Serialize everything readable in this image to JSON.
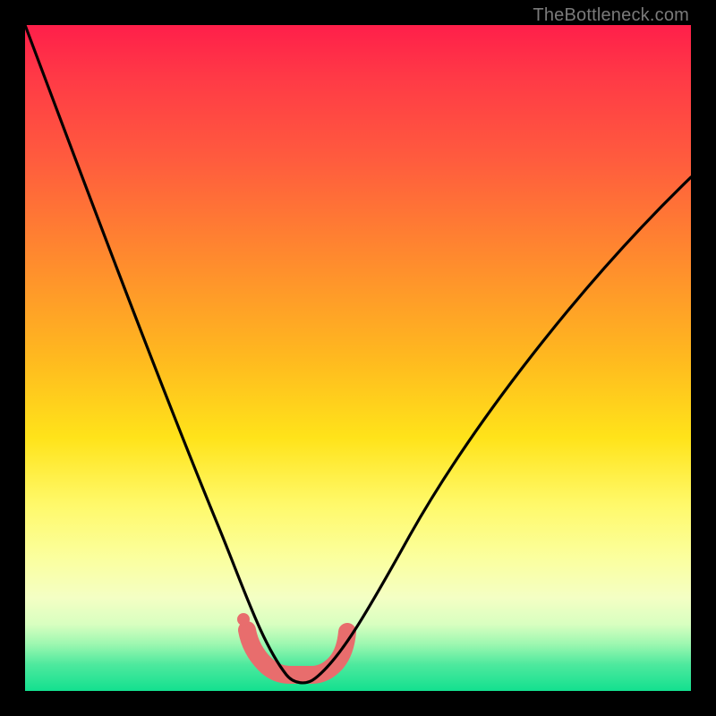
{
  "watermark": {
    "text": "TheBottleneck.com"
  },
  "chart_data": {
    "type": "line",
    "title": "",
    "xlabel": "",
    "ylabel": "",
    "xlim": [
      0,
      100
    ],
    "ylim": [
      0,
      100
    ],
    "grid": false,
    "legend": false,
    "series": [
      {
        "name": "curve",
        "x": [
          0,
          4,
          8,
          12,
          16,
          20,
          24,
          26,
          28,
          30,
          32,
          34,
          35,
          36,
          37,
          38,
          39,
          40,
          41,
          42,
          43,
          44,
          46,
          50,
          55,
          60,
          65,
          70,
          75,
          80,
          85,
          90,
          95,
          100
        ],
        "y": [
          100,
          90,
          80,
          71,
          62,
          53,
          44,
          38,
          33,
          27,
          21,
          15,
          12,
          9,
          6.5,
          4.5,
          3,
          2,
          1.3,
          1,
          1,
          1.2,
          3,
          8,
          15,
          22,
          30,
          37,
          44,
          51,
          58,
          65,
          71,
          77
        ]
      },
      {
        "name": "flat-marker-band",
        "x": [
          34.5,
          43.5
        ],
        "y": [
          3.2,
          3.2
        ]
      }
    ],
    "background_gradient": {
      "top_color": "#ff1f4a",
      "bottom_color": "#13e08f",
      "stops": [
        {
          "pct": 0,
          "color": "#ff1f4a"
        },
        {
          "pct": 20,
          "color": "#ff5b3e"
        },
        {
          "pct": 50,
          "color": "#ffb91f"
        },
        {
          "pct": 72,
          "color": "#fff96a"
        },
        {
          "pct": 90,
          "color": "#d8ffc0"
        },
        {
          "pct": 100,
          "color": "#13e08f"
        }
      ]
    },
    "annotations": [
      {
        "name": "flat-bottom-highlight",
        "shape": "rounded-band",
        "color": "#e86d6d",
        "x_range": [
          34.5,
          43.5
        ],
        "y_approx": 3.2
      }
    ]
  },
  "colors": {
    "curve": "#000000",
    "marker_band": "#e86d6d",
    "frame": "#000000",
    "watermark": "#7a7a7a"
  }
}
